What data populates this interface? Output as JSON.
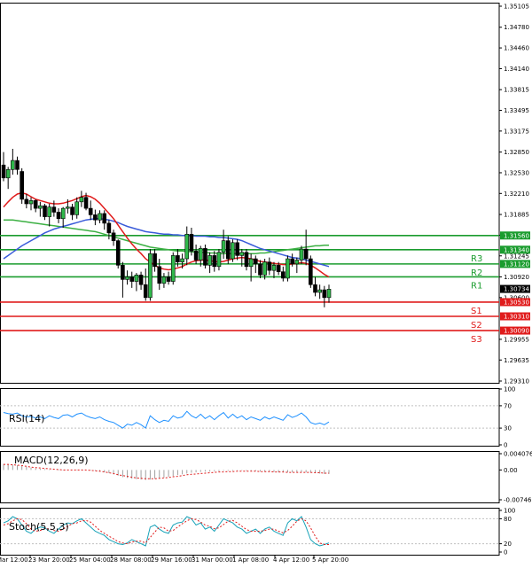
{
  "chart_data": {
    "type": "candlestick",
    "price_axis": {
      "ticks": [
        "1.35105",
        "1.34780",
        "1.34460",
        "1.34140",
        "1.33815",
        "1.33495",
        "1.33175",
        "1.32850",
        "1.32530",
        "1.32210",
        "1.31885",
        "1.31565",
        "1.31245",
        "1.30920",
        "1.30600",
        "1.29955",
        "1.29635",
        "1.29310"
      ],
      "tick_values": [
        1.35105,
        1.3478,
        1.3446,
        1.3414,
        1.33815,
        1.33495,
        1.33175,
        1.3285,
        1.3253,
        1.3221,
        1.31885,
        1.31565,
        1.31245,
        1.3092,
        1.306,
        1.29955,
        1.29635,
        1.2931
      ],
      "current_price": "1.30734",
      "current_value": 1.30734
    },
    "time_axis": [
      "Mar 12:00",
      "23 Mar 20:00",
      "25 Mar 04:00",
      "28 Mar 08:00",
      "29 Mar 16:00",
      "31 Mar 00:00",
      "1 Apr 08:00",
      "4 Apr 12:00",
      "5 Apr 20:00"
    ],
    "levels": [
      {
        "label": "",
        "tag": "1.31560",
        "value": 1.3156,
        "color": "#1a9c2e"
      },
      {
        "label": "R3",
        "tag": "1.31340",
        "value": 1.3134,
        "color": "#1a9c2e"
      },
      {
        "label": "R2",
        "tag": "1.31120",
        "value": 1.3112,
        "color": "#1a9c2e"
      },
      {
        "label": "R1",
        "tag": "",
        "value": 1.3092,
        "color": "#1a9c2e"
      },
      {
        "label": "S1",
        "tag": "1.30530",
        "value": 1.3053,
        "color": "#e01b1b"
      },
      {
        "label": "S2",
        "tag": "1.30310",
        "value": 1.3031,
        "color": "#e01b1b"
      },
      {
        "label": "S3",
        "tag": "1.30090",
        "value": 1.3009,
        "color": "#e01b1b"
      }
    ],
    "candles": [
      {
        "o": 1.3265,
        "h": 1.3285,
        "l": 1.324,
        "c": 1.3245
      },
      {
        "o": 1.3245,
        "h": 1.3262,
        "l": 1.3228,
        "c": 1.3258
      },
      {
        "o": 1.3258,
        "h": 1.329,
        "l": 1.325,
        "c": 1.3272
      },
      {
        "o": 1.3272,
        "h": 1.3278,
        "l": 1.325,
        "c": 1.3258
      },
      {
        "o": 1.3255,
        "h": 1.326,
        "l": 1.3205,
        "c": 1.3212
      },
      {
        "o": 1.3212,
        "h": 1.322,
        "l": 1.3198,
        "c": 1.3205
      },
      {
        "o": 1.3205,
        "h": 1.3215,
        "l": 1.3195,
        "c": 1.321
      },
      {
        "o": 1.321,
        "h": 1.3212,
        "l": 1.3192,
        "c": 1.3198
      },
      {
        "o": 1.3198,
        "h": 1.3208,
        "l": 1.3185,
        "c": 1.3202
      },
      {
        "o": 1.3202,
        "h": 1.3205,
        "l": 1.318,
        "c": 1.3185
      },
      {
        "o": 1.3185,
        "h": 1.3205,
        "l": 1.317,
        "c": 1.32
      },
      {
        "o": 1.32,
        "h": 1.321,
        "l": 1.3185,
        "c": 1.3192
      },
      {
        "o": 1.3192,
        "h": 1.3198,
        "l": 1.3175,
        "c": 1.3182
      },
      {
        "o": 1.3182,
        "h": 1.32,
        "l": 1.3168,
        "c": 1.3198
      },
      {
        "o": 1.3198,
        "h": 1.3212,
        "l": 1.319,
        "c": 1.32
      },
      {
        "o": 1.32,
        "h": 1.3205,
        "l": 1.318,
        "c": 1.3188
      },
      {
        "o": 1.3188,
        "h": 1.3215,
        "l": 1.3182,
        "c": 1.3208
      },
      {
        "o": 1.3208,
        "h": 1.3225,
        "l": 1.32,
        "c": 1.3215
      },
      {
        "o": 1.3215,
        "h": 1.3222,
        "l": 1.3195,
        "c": 1.3198
      },
      {
        "o": 1.3198,
        "h": 1.321,
        "l": 1.318,
        "c": 1.3188
      },
      {
        "o": 1.3188,
        "h": 1.3196,
        "l": 1.3172,
        "c": 1.318
      },
      {
        "o": 1.318,
        "h": 1.3195,
        "l": 1.3175,
        "c": 1.319
      },
      {
        "o": 1.319,
        "h": 1.3195,
        "l": 1.3165,
        "c": 1.3175
      },
      {
        "o": 1.3175,
        "h": 1.318,
        "l": 1.315,
        "c": 1.316
      },
      {
        "o": 1.316,
        "h": 1.3165,
        "l": 1.314,
        "c": 1.3148
      },
      {
        "o": 1.3148,
        "h": 1.315,
        "l": 1.3105,
        "c": 1.311
      },
      {
        "o": 1.311,
        "h": 1.3115,
        "l": 1.306,
        "c": 1.3088
      },
      {
        "o": 1.3088,
        "h": 1.3102,
        "l": 1.308,
        "c": 1.3092
      },
      {
        "o": 1.3092,
        "h": 1.31,
        "l": 1.3075,
        "c": 1.3085
      },
      {
        "o": 1.3085,
        "h": 1.3098,
        "l": 1.307,
        "c": 1.3095
      },
      {
        "o": 1.3095,
        "h": 1.31,
        "l": 1.3072,
        "c": 1.308
      },
      {
        "o": 1.308,
        "h": 1.3105,
        "l": 1.3055,
        "c": 1.306
      },
      {
        "o": 1.306,
        "h": 1.3135,
        "l": 1.3055,
        "c": 1.3128
      },
      {
        "o": 1.3128,
        "h": 1.3135,
        "l": 1.31,
        "c": 1.3108
      },
      {
        "o": 1.3108,
        "h": 1.312,
        "l": 1.3072,
        "c": 1.3082
      },
      {
        "o": 1.3082,
        "h": 1.3098,
        "l": 1.3075,
        "c": 1.3092
      },
      {
        "o": 1.3092,
        "h": 1.31,
        "l": 1.308,
        "c": 1.3085
      },
      {
        "o": 1.3085,
        "h": 1.313,
        "l": 1.308,
        "c": 1.3125
      },
      {
        "o": 1.3125,
        "h": 1.3135,
        "l": 1.3108,
        "c": 1.3115
      },
      {
        "o": 1.3115,
        "h": 1.3128,
        "l": 1.3105,
        "c": 1.312
      },
      {
        "o": 1.312,
        "h": 1.317,
        "l": 1.311,
        "c": 1.3158
      },
      {
        "o": 1.3158,
        "h": 1.3168,
        "l": 1.3125,
        "c": 1.3132
      },
      {
        "o": 1.3132,
        "h": 1.3142,
        "l": 1.3112,
        "c": 1.3118
      },
      {
        "o": 1.3118,
        "h": 1.314,
        "l": 1.3108,
        "c": 1.3136
      },
      {
        "o": 1.3136,
        "h": 1.3142,
        "l": 1.3105,
        "c": 1.311
      },
      {
        "o": 1.311,
        "h": 1.313,
        "l": 1.3098,
        "c": 1.3125
      },
      {
        "o": 1.3125,
        "h": 1.3132,
        "l": 1.31,
        "c": 1.3108
      },
      {
        "o": 1.3108,
        "h": 1.3135,
        "l": 1.3102,
        "c": 1.313
      },
      {
        "o": 1.313,
        "h": 1.3165,
        "l": 1.312,
        "c": 1.3148
      },
      {
        "o": 1.3148,
        "h": 1.3155,
        "l": 1.3112,
        "c": 1.312
      },
      {
        "o": 1.312,
        "h": 1.315,
        "l": 1.3115,
        "c": 1.3145
      },
      {
        "o": 1.3145,
        "h": 1.315,
        "l": 1.3118,
        "c": 1.3125
      },
      {
        "o": 1.3125,
        "h": 1.3135,
        "l": 1.3108,
        "c": 1.313
      },
      {
        "o": 1.313,
        "h": 1.3135,
        "l": 1.3102,
        "c": 1.3108
      },
      {
        "o": 1.3108,
        "h": 1.3128,
        "l": 1.3085,
        "c": 1.312
      },
      {
        "o": 1.312,
        "h": 1.3125,
        "l": 1.3098,
        "c": 1.3112
      },
      {
        "o": 1.3112,
        "h": 1.3118,
        "l": 1.309,
        "c": 1.3095
      },
      {
        "o": 1.3095,
        "h": 1.312,
        "l": 1.3088,
        "c": 1.3115
      },
      {
        "o": 1.3115,
        "h": 1.3122,
        "l": 1.3095,
        "c": 1.3102
      },
      {
        "o": 1.3102,
        "h": 1.3115,
        "l": 1.309,
        "c": 1.311
      },
      {
        "o": 1.311,
        "h": 1.3115,
        "l": 1.3095,
        "c": 1.31
      },
      {
        "o": 1.31,
        "h": 1.3108,
        "l": 1.3085,
        "c": 1.309
      },
      {
        "o": 1.309,
        "h": 1.3125,
        "l": 1.3085,
        "c": 1.312
      },
      {
        "o": 1.312,
        "h": 1.3128,
        "l": 1.3108,
        "c": 1.3112
      },
      {
        "o": 1.3112,
        "h": 1.3122,
        "l": 1.3098,
        "c": 1.3118
      },
      {
        "o": 1.3118,
        "h": 1.314,
        "l": 1.3112,
        "c": 1.3135
      },
      {
        "o": 1.3135,
        "h": 1.3165,
        "l": 1.311,
        "c": 1.312
      },
      {
        "o": 1.312,
        "h": 1.3125,
        "l": 1.3075,
        "c": 1.308
      },
      {
        "o": 1.308,
        "h": 1.3092,
        "l": 1.3062,
        "c": 1.3068
      },
      {
        "o": 1.3068,
        "h": 1.308,
        "l": 1.3058,
        "c": 1.3072
      },
      {
        "o": 1.3072,
        "h": 1.3078,
        "l": 1.3045,
        "c": 1.306
      },
      {
        "o": 1.306,
        "h": 1.308,
        "l": 1.3052,
        "c": 1.3073
      }
    ],
    "ma_red": [
      1.32,
      1.3208,
      1.3215,
      1.322,
      1.3222,
      1.322,
      1.3216,
      1.3212,
      1.321,
      1.3208,
      1.3206,
      1.3205,
      1.3205,
      1.3206,
      1.3208,
      1.321,
      1.3213,
      1.3216,
      1.3218,
      1.3216,
      1.3212,
      1.3206,
      1.3198,
      1.319,
      1.3182,
      1.3172,
      1.3162,
      1.3152,
      1.3143,
      1.3135,
      1.3128,
      1.312,
      1.3115,
      1.311,
      1.3106,
      1.3104,
      1.3103,
      1.3104,
      1.3106,
      1.3108,
      1.3112,
      1.3115,
      1.3117,
      1.3118,
      1.3118,
      1.3117,
      1.3116,
      1.3115,
      1.3116,
      1.3118,
      1.312,
      1.3121,
      1.3122,
      1.3121,
      1.312,
      1.3118,
      1.3116,
      1.3115,
      1.3114,
      1.3113,
      1.3112,
      1.3111,
      1.3111,
      1.3112,
      1.3113,
      1.3114,
      1.3113,
      1.311,
      1.3106,
      1.3101,
      1.3096,
      1.3092
    ],
    "ma_blue": [
      1.312,
      1.3125,
      1.313,
      1.3135,
      1.314,
      1.3144,
      1.3148,
      1.3152,
      1.3156,
      1.316,
      1.3163,
      1.3166,
      1.3168,
      1.317,
      1.3172,
      1.3174,
      1.3176,
      1.3178,
      1.318,
      1.3181,
      1.3182,
      1.3182,
      1.3181,
      1.318,
      1.3178,
      1.3176,
      1.3173,
      1.317,
      1.3168,
      1.3166,
      1.3164,
      1.3162,
      1.3161,
      1.316,
      1.3159,
      1.3158,
      1.3158,
      1.3157,
      1.3157,
      1.3156,
      1.3156,
      1.3156,
      1.3155,
      1.3155,
      1.3155,
      1.3154,
      1.3154,
      1.3153,
      1.3153,
      1.3152,
      1.3151,
      1.315,
      1.3148,
      1.3145,
      1.3142,
      1.3139,
      1.3136,
      1.3134,
      1.3132,
      1.313,
      1.3128,
      1.3126,
      1.3124,
      1.3122,
      1.3121,
      1.312,
      1.3118,
      1.3116,
      1.3114,
      1.3112,
      1.311,
      1.3108
    ],
    "ma_green": [
      1.318,
      1.318,
      1.318,
      1.3179,
      1.3178,
      1.3177,
      1.3176,
      1.3175,
      1.3174,
      1.3173,
      1.3172,
      1.3171,
      1.317,
      1.3169,
      1.3168,
      1.3167,
      1.3166,
      1.3165,
      1.3164,
      1.3163,
      1.3162,
      1.316,
      1.3158,
      1.3156,
      1.3154,
      1.3152,
      1.315,
      1.3148,
      1.3146,
      1.3144,
      1.3142,
      1.314,
      1.3138,
      1.3137,
      1.3136,
      1.3135,
      1.3134,
      1.3133,
      1.3132,
      1.3132,
      1.3131,
      1.3131,
      1.313,
      1.313,
      1.313,
      1.3129,
      1.3129,
      1.3128,
      1.3128,
      1.3128,
      1.3128,
      1.3128,
      1.3128,
      1.3128,
      1.3128,
      1.3128,
      1.3129,
      1.3129,
      1.313,
      1.3131,
      1.3132,
      1.3133,
      1.3134,
      1.3135,
      1.3136,
      1.3137,
      1.3138,
      1.3139,
      1.314,
      1.314,
      1.3141,
      1.3141
    ],
    "rsi": {
      "label": "RSI(14)",
      "ticks": [
        "100",
        "70",
        "30",
        "0"
      ],
      "tick_values": [
        100,
        70,
        30,
        0
      ],
      "values": [
        58,
        56,
        55,
        57,
        52,
        50,
        51,
        48,
        50,
        47,
        52,
        49,
        47,
        53,
        54,
        50,
        55,
        57,
        52,
        49,
        47,
        50,
        45,
        42,
        40,
        35,
        30,
        37,
        35,
        40,
        36,
        30,
        52,
        45,
        40,
        44,
        42,
        52,
        48,
        50,
        60,
        52,
        48,
        55,
        47,
        52,
        45,
        52,
        58,
        48,
        55,
        48,
        52,
        45,
        50,
        47,
        44,
        50,
        46,
        50,
        47,
        44,
        54,
        49,
        52,
        57,
        50,
        40,
        37,
        39,
        36,
        41
      ]
    },
    "macd": {
      "label": "MACD(12,26,9)",
      "ticks": [
        "0.004076",
        "0.00",
        "-0.007466"
      ],
      "tick_values": [
        0.004076,
        0,
        -0.007466
      ],
      "hist": [
        0.0015,
        0.0014,
        0.0013,
        0.0012,
        0.001,
        0.0008,
        0.0006,
        0.0004,
        0.0003,
        0.0002,
        0.0001,
        0.0,
        -0.0001,
        -0.0001,
        0.0,
        0.0,
        0.0001,
        0.0001,
        0.0,
        -0.0001,
        -0.0002,
        -0.0004,
        -0.0006,
        -0.0008,
        -0.0011,
        -0.0014,
        -0.0018,
        -0.002,
        -0.0022,
        -0.0023,
        -0.0024,
        -0.0025,
        -0.0024,
        -0.0022,
        -0.0021,
        -0.0019,
        -0.0017,
        -0.0015,
        -0.0013,
        -0.0011,
        -0.0009,
        -0.0007,
        -0.0006,
        -0.0005,
        -0.0004,
        -0.0004,
        -0.0003,
        -0.0003,
        -0.0002,
        -0.0002,
        -0.0002,
        -0.0001,
        -0.0001,
        -0.0002,
        -0.0002,
        -0.0003,
        -0.0004,
        -0.0004,
        -0.0005,
        -0.0005,
        -0.0006,
        -0.0006,
        -0.0006,
        -0.0006,
        -0.0005,
        -0.0005,
        -0.0006,
        -0.0007,
        -0.0008,
        -0.0009,
        -0.001,
        -0.001
      ],
      "signal": [
        0.0014,
        0.0014,
        0.0013,
        0.0012,
        0.0011,
        0.0009,
        0.0007,
        0.0006,
        0.0005,
        0.0004,
        0.0003,
        0.0002,
        0.0001,
        0.0,
        0.0,
        0.0,
        0.0,
        0.0,
        0.0,
        -0.0001,
        -0.0002,
        -0.0003,
        -0.0005,
        -0.0007,
        -0.0009,
        -0.0012,
        -0.0014,
        -0.0016,
        -0.0018,
        -0.002,
        -0.0021,
        -0.0022,
        -0.0022,
        -0.0022,
        -0.0021,
        -0.002,
        -0.0019,
        -0.0017,
        -0.0016,
        -0.0014,
        -0.0012,
        -0.0011,
        -0.001,
        -0.0009,
        -0.0008,
        -0.0007,
        -0.0006,
        -0.0005,
        -0.0005,
        -0.0004,
        -0.0004,
        -0.0003,
        -0.0003,
        -0.0003,
        -0.0003,
        -0.0003,
        -0.0004,
        -0.0004,
        -0.0004,
        -0.0005,
        -0.0005,
        -0.0005,
        -0.0006,
        -0.0006,
        -0.0006,
        -0.0006,
        -0.0006,
        -0.0006,
        -0.0007,
        -0.0007,
        -0.0008,
        -0.0008
      ]
    },
    "stoch": {
      "label": "Stoch(5,5,3)",
      "ticks": [
        "100",
        "80",
        "20",
        "0"
      ],
      "tick_values": [
        100,
        80,
        20,
        0
      ],
      "main": [
        70,
        75,
        85,
        80,
        65,
        50,
        45,
        55,
        60,
        58,
        50,
        45,
        55,
        65,
        70,
        68,
        75,
        80,
        70,
        60,
        50,
        45,
        40,
        30,
        25,
        20,
        18,
        22,
        30,
        25,
        20,
        15,
        60,
        65,
        55,
        48,
        45,
        65,
        70,
        72,
        85,
        80,
        65,
        70,
        55,
        60,
        50,
        65,
        80,
        75,
        70,
        60,
        55,
        45,
        50,
        55,
        45,
        55,
        60,
        50,
        45,
        40,
        70,
        80,
        75,
        85,
        60,
        30,
        20,
        15,
        18,
        22
      ],
      "signal": [
        65,
        68,
        75,
        80,
        78,
        68,
        55,
        50,
        52,
        56,
        56,
        52,
        50,
        55,
        62,
        68,
        70,
        75,
        76,
        72,
        62,
        52,
        45,
        38,
        32,
        25,
        22,
        20,
        24,
        26,
        26,
        22,
        35,
        48,
        60,
        58,
        50,
        52,
        60,
        68,
        75,
        80,
        78,
        72,
        65,
        62,
        56,
        58,
        66,
        74,
        76,
        70,
        62,
        54,
        50,
        50,
        50,
        52,
        55,
        55,
        50,
        46,
        52,
        62,
        74,
        80,
        75,
        58,
        38,
        22,
        18,
        18
      ]
    }
  }
}
